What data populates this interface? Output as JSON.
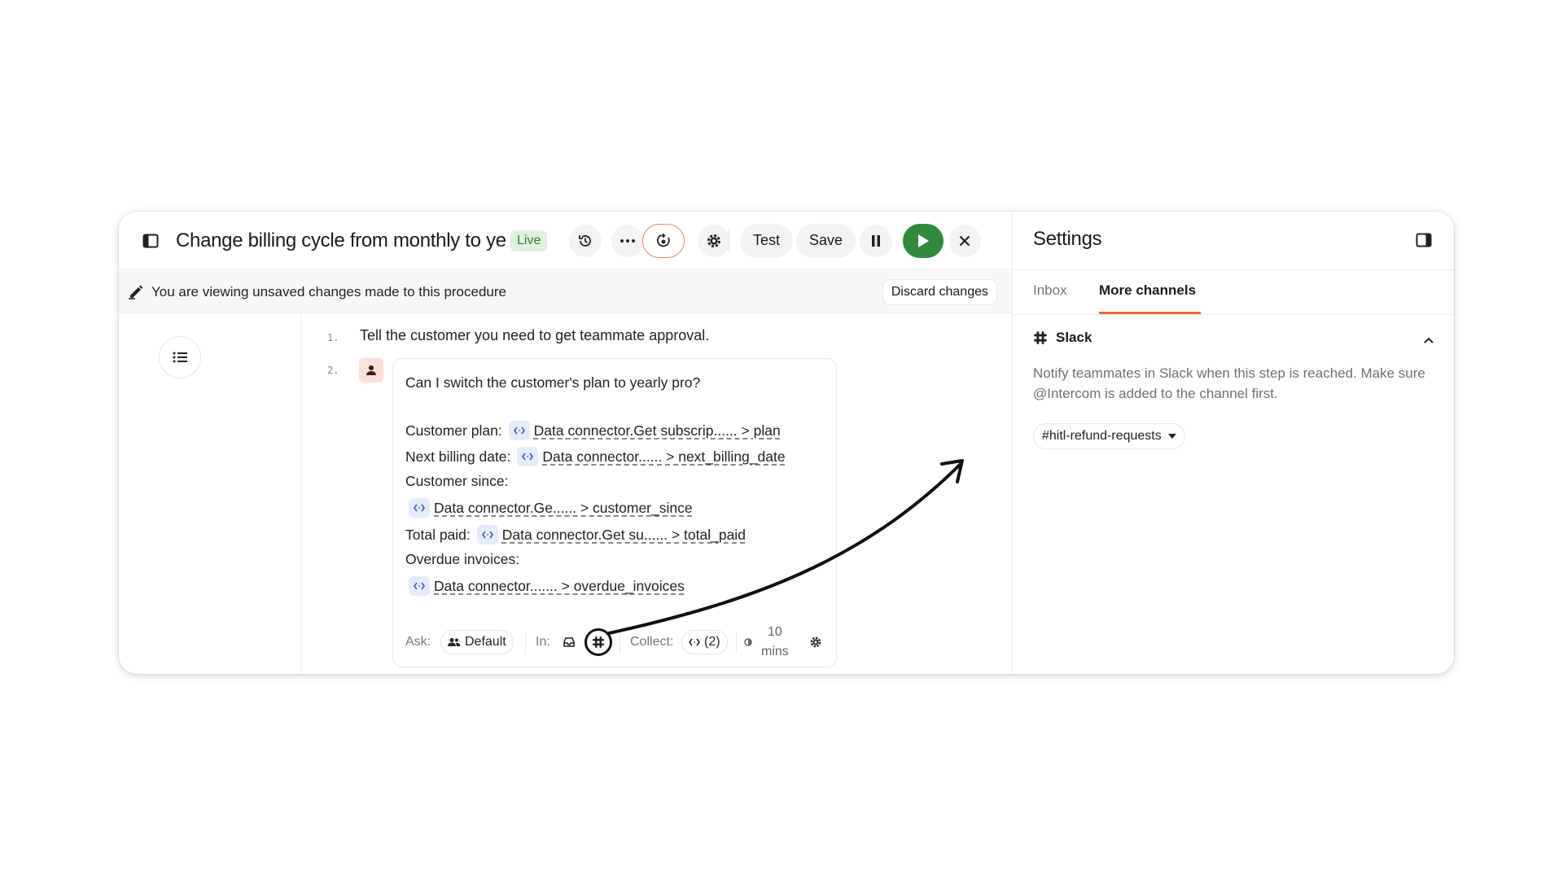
{
  "header": {
    "title": "Change billing cycle from monthly to yearly",
    "status_badge": "Live",
    "test_label": "Test",
    "save_label": "Save"
  },
  "notice": {
    "text": "You are viewing unsaved changes made to this procedure",
    "discard_label": "Discard changes"
  },
  "steps": [
    {
      "number": "1.",
      "text": "Tell the customer you need to get teammate approval."
    },
    {
      "number": "2.",
      "type": "ask-teammate"
    }
  ],
  "card": {
    "question": "Can I switch the customer's plan to yearly pro?",
    "fields": [
      {
        "label": "Customer plan:",
        "ref": "Data connector.Get subscrip...... > plan"
      },
      {
        "label": "Next billing date:",
        "ref": "Data connector...... > next_billing_date"
      },
      {
        "label": "Customer since:",
        "ref": "Data connector.Ge...... > customer_since"
      },
      {
        "label": "Total paid:",
        "ref": "Data connector.Get su...... > total_paid"
      },
      {
        "label": "Overdue invoices:",
        "ref": "Data connector....... > overdue_invoices"
      }
    ],
    "footer": {
      "ask_label": "Ask:",
      "ask_value": "Default",
      "in_label": "In:",
      "collect_label": "Collect:",
      "collect_value": "(2)",
      "timeout_value": "10",
      "timeout_unit": "mins"
    }
  },
  "settings": {
    "title": "Settings",
    "tabs": [
      {
        "label": "Inbox",
        "active": false
      },
      {
        "label": "More channels",
        "active": true
      }
    ],
    "slack": {
      "label": "Slack",
      "description": "Notify teammates in Slack when this step is reached. Make sure @Intercom is added to the channel first.",
      "channel": "#hitl-refund-requests"
    }
  },
  "colors": {
    "accent": "#f0693c",
    "live_bg": "#dff1dc",
    "live_text": "#2e7d32",
    "play_button": "#2e8b3a",
    "variable_chip": "#e4ecfb"
  }
}
